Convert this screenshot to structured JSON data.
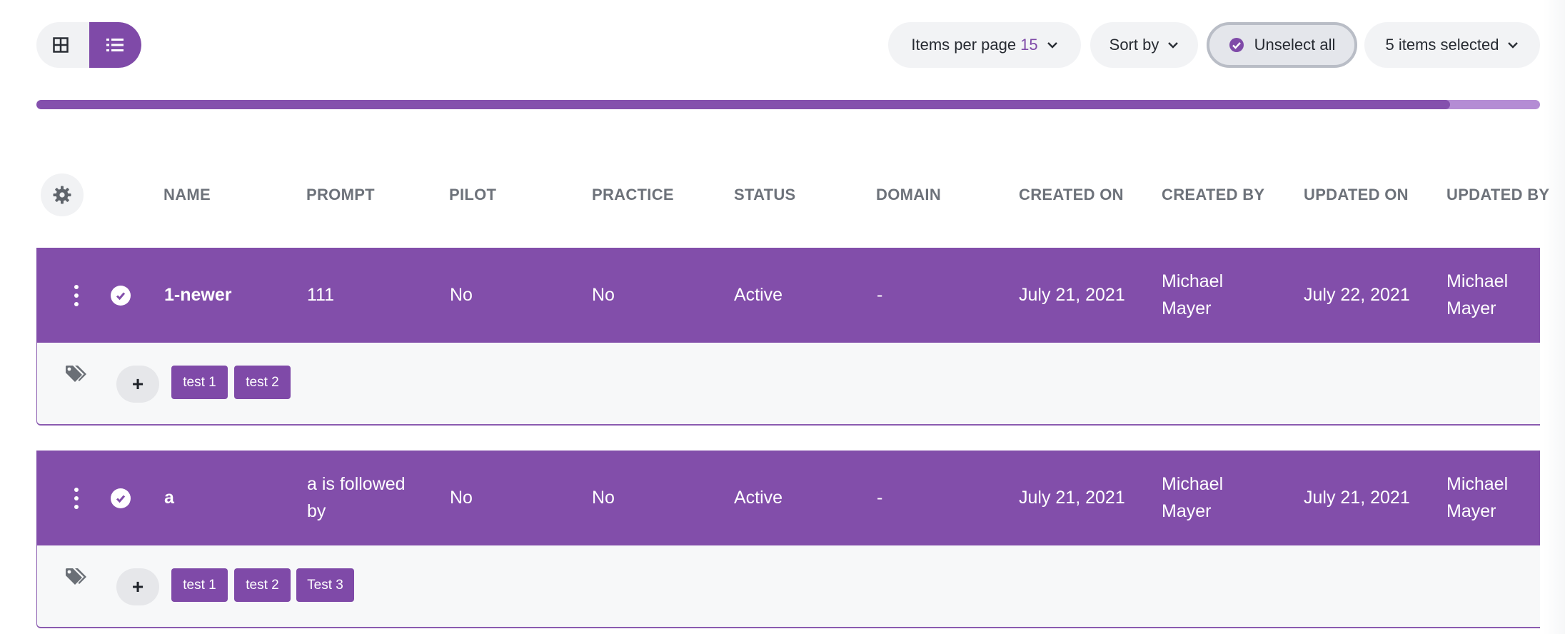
{
  "toolbar": {
    "view_grid_icon": "grid-icon",
    "view_list_icon": "list-icon",
    "items_per_page_label": "Items per page",
    "items_per_page_value": "15",
    "sort_by_label": "Sort by",
    "unselect_all_label": "Unselect all",
    "selected_label": "5 items selected"
  },
  "progress": {
    "fraction": 0.94
  },
  "table": {
    "columns": [
      "NAME",
      "PROMPT",
      "PILOT",
      "PRACTICE",
      "STATUS",
      "DOMAIN",
      "CREATED ON",
      "CREATED BY",
      "UPDATED ON",
      "UPDATED BY"
    ],
    "rows": [
      {
        "name": "1-newer",
        "prompt": "111",
        "pilot": "No",
        "practice": "No",
        "status": "Active",
        "domain": "-",
        "created_on": "July 21, 2021",
        "created_by": "Michael Mayer",
        "updated_on": "July 22, 2021",
        "updated_by": "Michael Mayer",
        "tags": [
          "test 1",
          "test 2"
        ],
        "add_label": "+"
      },
      {
        "name": "a",
        "prompt": "a is followed by",
        "pilot": "No",
        "practice": "No",
        "status": "Active",
        "domain": "-",
        "created_on": "July 21, 2021",
        "created_by": "Michael Mayer",
        "updated_on": "July 21, 2021",
        "updated_by": "Michael Mayer",
        "tags": [
          "test 1",
          "test 2",
          "Test 3"
        ],
        "add_label": "+"
      }
    ]
  },
  "colors": {
    "accent": "#824eaa",
    "accent_light": "#b48cd4",
    "tag_bg": "#7f4aa8"
  }
}
